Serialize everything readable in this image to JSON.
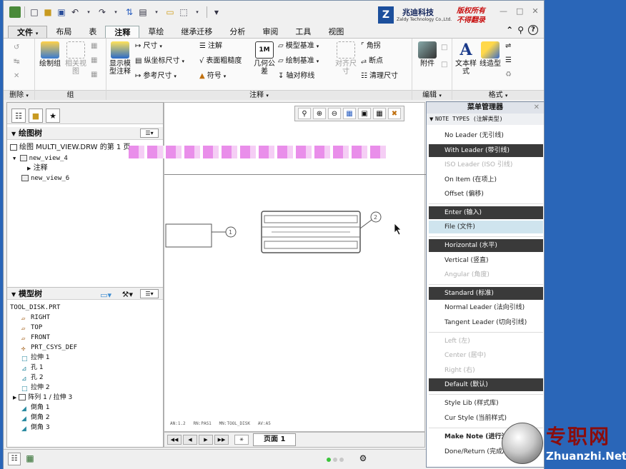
{
  "brand": {
    "company_cn": "兆迪科技",
    "company_en": "Zaldy Technology Co.,Ltd.",
    "copyright_1": "版权所有",
    "copyright_2": "不得翻录"
  },
  "tabs": {
    "file": "文件",
    "items": [
      "布局",
      "表",
      "注释",
      "草绘",
      "继承迁移",
      "分析",
      "审阅",
      "工具",
      "视图"
    ],
    "active_index": 2
  },
  "ribbon": {
    "delete_group": "删除",
    "group_group": "组",
    "annotate_group": "注释",
    "edit_group": "编辑",
    "format_group": "格式",
    "draw_group": "绘制组",
    "relative_view": "相关视图",
    "show_model_annotation": "显示模型注释",
    "dimension": "尺寸",
    "ordinate_dimension": "纵坐标尺寸",
    "reference_dimension": "参考尺寸",
    "note": "注解",
    "surface_finish": "表面粗糙度",
    "symbol": "符号",
    "geometric_tolerance": "几何公差",
    "model_datum": "模型基准",
    "draw_datum": "绘制基准",
    "axis_symmetry": "轴对称线",
    "align_dimension": "对齐尺寸",
    "corner": "角拐",
    "breakpoint": "断点",
    "cleanup_dimension": "清理尺寸",
    "attachment": "附件",
    "text_style": "文本样式",
    "line_style": "线造型"
  },
  "drawing_tree": {
    "title": "绘图树",
    "items": [
      "绘图 MULTI_VIEW.DRW 的第 1 页",
      "new_view_4",
      "注释",
      "new_view_6"
    ]
  },
  "model_tree": {
    "title": "模型树",
    "root": "TOOL_DISK.PRT",
    "items": [
      "RIGHT",
      "TOP",
      "FRONT",
      "PRT_CSYS_DEF",
      "拉伸 1",
      "孔 1",
      "孔 2",
      "拉伸 2",
      "阵列 1 / 拉伸 3",
      "倒角 1",
      "倒角 2",
      "倒角 3"
    ]
  },
  "canvas": {
    "balloon_1": "1",
    "balloon_2": "2",
    "info_line": "AN:1.2   RN:PAS1   MN:TOOL_DISK   AV:A5"
  },
  "page_nav": {
    "page_label": "页面 1"
  },
  "menu_manager": {
    "title": "菜单管理器",
    "section": "NOTE TYPES (注解类型)",
    "items": [
      {
        "label": "No Leader (无引线)",
        "state": "normal"
      },
      {
        "label": "With Leader (带引线)",
        "state": "selected"
      },
      {
        "label": "ISO Leader (ISO 引线)",
        "state": "disabled"
      },
      {
        "label": "On Item (在项上)",
        "state": "normal"
      },
      {
        "label": "Offset (偏移)",
        "state": "normal"
      },
      {
        "label": "Enter (输入)",
        "state": "selected"
      },
      {
        "label": "File (文件)",
        "state": "hover"
      },
      {
        "label": "Horizontal (水平)",
        "state": "selected"
      },
      {
        "label": "Vertical (竖直)",
        "state": "normal"
      },
      {
        "label": "Angular (角度)",
        "state": "disabled"
      },
      {
        "label": "Standard (标准)",
        "state": "selected"
      },
      {
        "label": "Normal Leader (法向引线)",
        "state": "normal"
      },
      {
        "label": "Tangent Leader (切向引线)",
        "state": "normal"
      },
      {
        "label": "Left (左)",
        "state": "disabled"
      },
      {
        "label": "Center (居中)",
        "state": "disabled"
      },
      {
        "label": "Right (右)",
        "state": "disabled"
      },
      {
        "label": "Default (默认)",
        "state": "selected"
      },
      {
        "label": "Style Lib (样式库)",
        "state": "normal"
      },
      {
        "label": "Cur Style (当前样式)",
        "state": "normal"
      },
      {
        "label": "Make Note (进行注解)",
        "state": "bold"
      },
      {
        "label": "Done/Return (完成/返回)",
        "state": "normal"
      }
    ]
  },
  "watermark": {
    "cn": "专职网",
    "url": "Zhuanzhi.Net"
  }
}
